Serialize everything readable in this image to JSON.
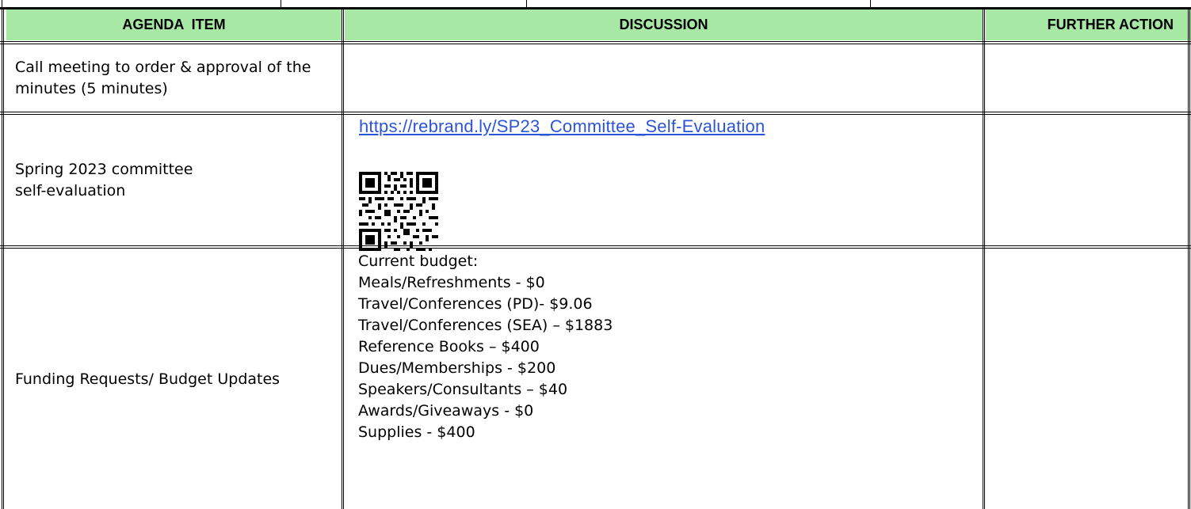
{
  "headers": {
    "agenda": "AGENDA  ITEM",
    "discussion": "DISCUSSION",
    "action": "FURTHER ACTION"
  },
  "rows": [
    {
      "item": "Call meeting to order & approval of the minutes (5 minutes)"
    },
    {
      "item": "Spring 2023 committee self-evaluation",
      "link": "https://rebrand.ly/SP23_Committee_Self-Evaluation",
      "qr": "qr-code"
    },
    {
      "item": "Funding Requests/ Budget Updates",
      "budget_title": "Current budget:",
      "budget_lines": [
        "Meals/Refreshments - $0",
        "Travel/Conferences (PD)- $9.06",
        "Travel/Conferences (SEA) – $1883",
        "Reference Books – $400",
        "Dues/Memberships - $200",
        "Speakers/Consultants – $40",
        "Awards/Giveaways - $0",
        "Supplies - $400"
      ]
    }
  ],
  "colors": {
    "header_bg": "#a6e8a4",
    "link": "#2b55d6",
    "border": "#000000"
  }
}
